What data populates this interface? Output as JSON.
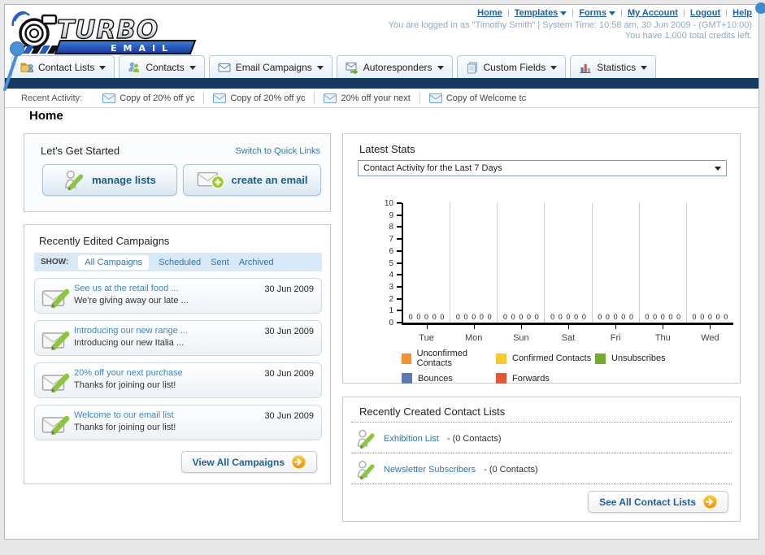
{
  "logo": {
    "title": "TURBO",
    "subtitle": "EMAIL"
  },
  "header": {
    "links": [
      {
        "label": "Home",
        "icon": null
      },
      {
        "label": "Templates",
        "icon": "chevron-down-icon"
      },
      {
        "label": "Forms",
        "icon": "chevron-down-icon"
      },
      {
        "label": "My Account",
        "icon": null
      },
      {
        "label": "Logout",
        "icon": null
      },
      {
        "label": "Help",
        "icon": null
      }
    ],
    "login_line1": "You are logged in as \"Timothy Smith\" | System Time: 10:58 am, 30 Jun 2009 - (GMT+10:00)",
    "login_line2": "You have 1,000 total credits left."
  },
  "nav": {
    "tabs": [
      {
        "label": "Contact Lists",
        "icon": "folder-user-icon"
      },
      {
        "label": "Contacts",
        "icon": "people-icon"
      },
      {
        "label": "Email Campaigns",
        "icon": "envelope-icon"
      },
      {
        "label": "Autoresponders",
        "icon": "envelope-arrow-icon"
      },
      {
        "label": "Custom Fields",
        "icon": "pages-icon"
      },
      {
        "label": "Statistics",
        "icon": "bar-chart-icon"
      }
    ]
  },
  "recent_activity": {
    "label": "Recent Activity:",
    "items": [
      {
        "label": "Copy of 20% off yc",
        "icon": "envelope-icon"
      },
      {
        "label": "Copy of 20% off yc",
        "icon": "envelope-icon"
      },
      {
        "label": "20% off your next",
        "icon": "envelope-icon"
      },
      {
        "label": "Copy of Welcome tc",
        "icon": "envelope-icon"
      }
    ]
  },
  "page": {
    "title": "Home"
  },
  "get_started": {
    "title": "Let's Get Started",
    "switch_link": "Switch to Quick Links",
    "manage_lists_label": "manage lists",
    "create_email_label": "create an email"
  },
  "campaigns": {
    "title": "Recently Edited Campaigns",
    "show_label": "SHOW:",
    "filters": [
      {
        "label": "All Campaigns",
        "active": true
      },
      {
        "label": "Scheduled",
        "active": false
      },
      {
        "label": "Sent",
        "active": false
      },
      {
        "label": "Archived",
        "active": false
      }
    ],
    "items": [
      {
        "title": "See us at the retail food ...",
        "subtitle": "We're giving away our late ...",
        "date": "30 Jun 2009"
      },
      {
        "title": "Introducing our new range ...",
        "subtitle": "Introducing our new Italia ...",
        "date": "30 Jun 2009"
      },
      {
        "title": "20% off your next purchase",
        "subtitle": "Thanks for joining our list!",
        "date": "30 Jun 2009"
      },
      {
        "title": "Welcome to our email list",
        "subtitle": "Thanks for joining our list!",
        "date": "30 Jun 2009"
      }
    ],
    "view_all_label": "View All Campaigns"
  },
  "stats": {
    "title": "Latest Stats",
    "select_value": "Contact Activity for the Last 7 Days"
  },
  "chart_data": {
    "type": "bar",
    "title": "Contact Activity for the Last 7 Days",
    "categories": [
      "Tue",
      "Mon",
      "Sun",
      "Sat",
      "Fri",
      "Thu",
      "Wed"
    ],
    "series": [
      {
        "name": "Unconfirmed Contacts",
        "color": "#F5922F",
        "values": [
          0,
          0,
          0,
          0,
          0,
          0,
          0
        ]
      },
      {
        "name": "Confirmed Contacts",
        "color": "#FBC82F",
        "values": [
          0,
          0,
          0,
          0,
          0,
          0,
          0
        ]
      },
      {
        "name": "Unsubscribes",
        "color": "#74AB2C",
        "values": [
          0,
          0,
          0,
          0,
          0,
          0,
          0
        ]
      },
      {
        "name": "Bounces",
        "color": "#5A79B5",
        "values": [
          0,
          0,
          0,
          0,
          0,
          0,
          0
        ]
      },
      {
        "name": "Forwards",
        "color": "#E85530",
        "values": [
          0,
          0,
          0,
          0,
          0,
          0,
          0
        ]
      }
    ],
    "ylim": [
      0,
      10
    ],
    "y_ticks": [
      0,
      1,
      2,
      3,
      4,
      5,
      6,
      7,
      8,
      9,
      10
    ],
    "grid": "vertical-only",
    "legend_position": "bottom",
    "value_labels_shown": true
  },
  "contact_lists": {
    "title": "Recently Created Contact Lists",
    "items": [
      {
        "name": "Exhibition List",
        "detail": "- (0 Contacts)"
      },
      {
        "name": "Newsletter Subscribers",
        "detail": "- (0 Contacts)"
      }
    ],
    "see_all_label": "See All Contact Lists"
  }
}
